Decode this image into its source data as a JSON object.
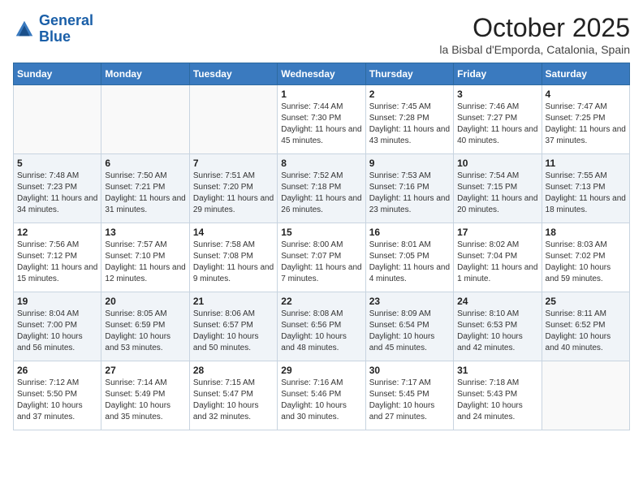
{
  "header": {
    "logo_line1": "General",
    "logo_line2": "Blue",
    "month": "October 2025",
    "location": "la Bisbal d'Emporda, Catalonia, Spain"
  },
  "weekdays": [
    "Sunday",
    "Monday",
    "Tuesday",
    "Wednesday",
    "Thursday",
    "Friday",
    "Saturday"
  ],
  "weeks": [
    [
      {
        "day": "",
        "info": ""
      },
      {
        "day": "",
        "info": ""
      },
      {
        "day": "",
        "info": ""
      },
      {
        "day": "1",
        "info": "Sunrise: 7:44 AM\nSunset: 7:30 PM\nDaylight: 11 hours and 45 minutes."
      },
      {
        "day": "2",
        "info": "Sunrise: 7:45 AM\nSunset: 7:28 PM\nDaylight: 11 hours and 43 minutes."
      },
      {
        "day": "3",
        "info": "Sunrise: 7:46 AM\nSunset: 7:27 PM\nDaylight: 11 hours and 40 minutes."
      },
      {
        "day": "4",
        "info": "Sunrise: 7:47 AM\nSunset: 7:25 PM\nDaylight: 11 hours and 37 minutes."
      }
    ],
    [
      {
        "day": "5",
        "info": "Sunrise: 7:48 AM\nSunset: 7:23 PM\nDaylight: 11 hours and 34 minutes."
      },
      {
        "day": "6",
        "info": "Sunrise: 7:50 AM\nSunset: 7:21 PM\nDaylight: 11 hours and 31 minutes."
      },
      {
        "day": "7",
        "info": "Sunrise: 7:51 AM\nSunset: 7:20 PM\nDaylight: 11 hours and 29 minutes."
      },
      {
        "day": "8",
        "info": "Sunrise: 7:52 AM\nSunset: 7:18 PM\nDaylight: 11 hours and 26 minutes."
      },
      {
        "day": "9",
        "info": "Sunrise: 7:53 AM\nSunset: 7:16 PM\nDaylight: 11 hours and 23 minutes."
      },
      {
        "day": "10",
        "info": "Sunrise: 7:54 AM\nSunset: 7:15 PM\nDaylight: 11 hours and 20 minutes."
      },
      {
        "day": "11",
        "info": "Sunrise: 7:55 AM\nSunset: 7:13 PM\nDaylight: 11 hours and 18 minutes."
      }
    ],
    [
      {
        "day": "12",
        "info": "Sunrise: 7:56 AM\nSunset: 7:12 PM\nDaylight: 11 hours and 15 minutes."
      },
      {
        "day": "13",
        "info": "Sunrise: 7:57 AM\nSunset: 7:10 PM\nDaylight: 11 hours and 12 minutes."
      },
      {
        "day": "14",
        "info": "Sunrise: 7:58 AM\nSunset: 7:08 PM\nDaylight: 11 hours and 9 minutes."
      },
      {
        "day": "15",
        "info": "Sunrise: 8:00 AM\nSunset: 7:07 PM\nDaylight: 11 hours and 7 minutes."
      },
      {
        "day": "16",
        "info": "Sunrise: 8:01 AM\nSunset: 7:05 PM\nDaylight: 11 hours and 4 minutes."
      },
      {
        "day": "17",
        "info": "Sunrise: 8:02 AM\nSunset: 7:04 PM\nDaylight: 11 hours and 1 minute."
      },
      {
        "day": "18",
        "info": "Sunrise: 8:03 AM\nSunset: 7:02 PM\nDaylight: 10 hours and 59 minutes."
      }
    ],
    [
      {
        "day": "19",
        "info": "Sunrise: 8:04 AM\nSunset: 7:00 PM\nDaylight: 10 hours and 56 minutes."
      },
      {
        "day": "20",
        "info": "Sunrise: 8:05 AM\nSunset: 6:59 PM\nDaylight: 10 hours and 53 minutes."
      },
      {
        "day": "21",
        "info": "Sunrise: 8:06 AM\nSunset: 6:57 PM\nDaylight: 10 hours and 50 minutes."
      },
      {
        "day": "22",
        "info": "Sunrise: 8:08 AM\nSunset: 6:56 PM\nDaylight: 10 hours and 48 minutes."
      },
      {
        "day": "23",
        "info": "Sunrise: 8:09 AM\nSunset: 6:54 PM\nDaylight: 10 hours and 45 minutes."
      },
      {
        "day": "24",
        "info": "Sunrise: 8:10 AM\nSunset: 6:53 PM\nDaylight: 10 hours and 42 minutes."
      },
      {
        "day": "25",
        "info": "Sunrise: 8:11 AM\nSunset: 6:52 PM\nDaylight: 10 hours and 40 minutes."
      }
    ],
    [
      {
        "day": "26",
        "info": "Sunrise: 7:12 AM\nSunset: 5:50 PM\nDaylight: 10 hours and 37 minutes."
      },
      {
        "day": "27",
        "info": "Sunrise: 7:14 AM\nSunset: 5:49 PM\nDaylight: 10 hours and 35 minutes."
      },
      {
        "day": "28",
        "info": "Sunrise: 7:15 AM\nSunset: 5:47 PM\nDaylight: 10 hours and 32 minutes."
      },
      {
        "day": "29",
        "info": "Sunrise: 7:16 AM\nSunset: 5:46 PM\nDaylight: 10 hours and 30 minutes."
      },
      {
        "day": "30",
        "info": "Sunrise: 7:17 AM\nSunset: 5:45 PM\nDaylight: 10 hours and 27 minutes."
      },
      {
        "day": "31",
        "info": "Sunrise: 7:18 AM\nSunset: 5:43 PM\nDaylight: 10 hours and 24 minutes."
      },
      {
        "day": "",
        "info": ""
      }
    ]
  ]
}
